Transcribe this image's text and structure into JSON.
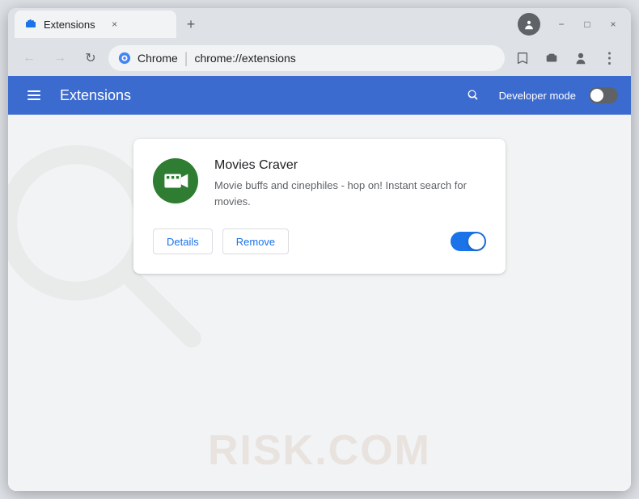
{
  "window": {
    "title": "Extensions",
    "tab_label": "Extensions",
    "close_label": "×",
    "minimize_label": "−",
    "maximize_label": "□"
  },
  "toolbar": {
    "back_label": "←",
    "forward_label": "→",
    "reload_label": "↻",
    "chrome_label": "Chrome",
    "address": "chrome://extensions",
    "bookmark_label": "☆",
    "extensions_label": "🧩",
    "profile_label": "👤",
    "menu_label": "⋮",
    "profile_circle_label": "▼"
  },
  "header": {
    "menu_label": "≡",
    "title": "Extensions",
    "search_label": "🔍",
    "dev_mode_label": "Developer mode"
  },
  "extension": {
    "name": "Movies Craver",
    "description": "Movie buffs and cinephiles - hop on! Instant search for movies.",
    "details_label": "Details",
    "remove_label": "Remove",
    "enabled": true
  },
  "watermark": {
    "text": "RISK.COM"
  }
}
